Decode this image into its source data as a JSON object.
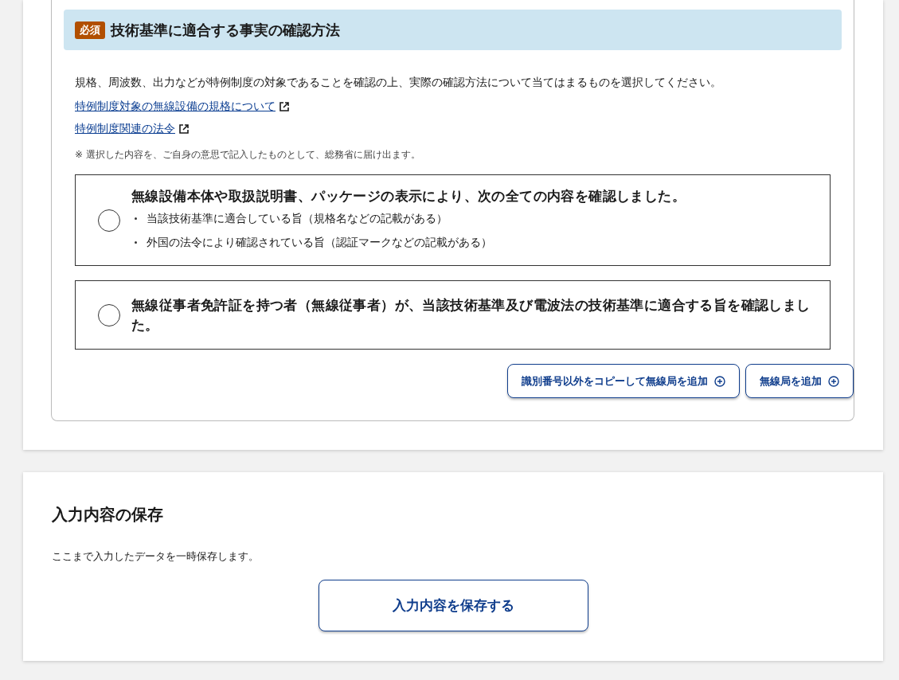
{
  "section": {
    "required_badge": "必須",
    "title": "技術基準に適合する事実の確認方法",
    "description": "規格、周波数、出力などが特例制度の対象であることを確認の上、実際の確認方法について当てはまるものを選択してください。",
    "links": [
      {
        "label": "特例制度対象の無線設備の規格について"
      },
      {
        "label": "特例制度関連の法令"
      }
    ],
    "note": "※ 選択した内容を、ご自身の意思で記入したものとして、総務省に届け出ます。",
    "options": [
      {
        "label": "無線設備本体や取扱説明書、パッケージの表示により、次の全ての内容を確認しました。",
        "selected": false,
        "bullets": [
          "当該技術基準に適合している旨（規格名などの記載がある）",
          "外国の法令により確認されている旨（認証マークなどの記載がある）"
        ]
      },
      {
        "label": "無線従事者免許証を持つ者（無線従事者）が、当該技術基準及び電波法の技術基準に適合する旨を確認しました。",
        "selected": false
      }
    ],
    "buttons": [
      "識別番号以外をコピーして無線局を追加",
      "無線局を追加"
    ]
  },
  "save": {
    "title": "入力内容の保存",
    "description": "ここまで入力したデータを一時保存します。",
    "button": "入力内容を保存する"
  }
}
